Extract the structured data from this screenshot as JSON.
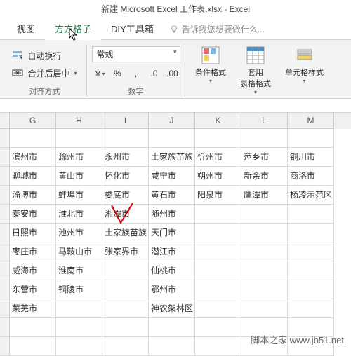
{
  "title": "新建 Microsoft Excel 工作表.xlsx - Excel",
  "tabs": {
    "view": "视图",
    "ffgz": "方方格子",
    "diy": "DIY工具箱"
  },
  "tell_me": "告诉我您想要做什么...",
  "alignment": {
    "wrap": "自动换行",
    "merge": "合并后居中",
    "label": "对齐方式"
  },
  "number": {
    "format": "常规",
    "label": "数字",
    "currency": "￥",
    "percent": "%",
    "comma": ",",
    "dec_inc": ".0",
    "dec_dec": ".00"
  },
  "styles": {
    "cond": "条件格式",
    "table": "套用\n表格格式",
    "cell": "单元格样式"
  },
  "columns": [
    "G",
    "H",
    "I",
    "J",
    "K",
    "L",
    "M"
  ],
  "grid": [
    [
      "",
      "",
      "",
      "",
      "",
      "",
      ""
    ],
    [
      "滨州市",
      "滁州市",
      "永州市",
      "土家族苗族自",
      "忻州市",
      "萍乡市",
      "铜川市"
    ],
    [
      "聊城市",
      "黄山市",
      "怀化市",
      "咸宁市",
      "朔州市",
      "新余市",
      "商洛市"
    ],
    [
      "淄博市",
      "蚌埠市",
      "娄底市",
      "黄石市",
      "阳泉市",
      "鹰潭市",
      "杨凌示范区"
    ],
    [
      "泰安市",
      "淮北市",
      "湘潭市",
      "随州市",
      "",
      "",
      ""
    ],
    [
      "日照市",
      "池州市",
      "土家族苗族自",
      "天门市",
      "",
      "",
      ""
    ],
    [
      "枣庄市",
      "马鞍山市",
      "张家界市",
      "潜江市",
      "",
      "",
      ""
    ],
    [
      "威海市",
      "淮南市",
      "",
      "仙桃市",
      "",
      "",
      ""
    ],
    [
      "东营市",
      "铜陵市",
      "",
      "鄂州市",
      "",
      "",
      ""
    ],
    [
      "莱芜市",
      "",
      "",
      "神农架林区",
      "",
      "",
      ""
    ],
    [
      "",
      "",
      "",
      "",
      "",
      "",
      ""
    ],
    [
      "",
      "",
      "",
      "",
      "",
      "",
      ""
    ]
  ],
  "footer": "脚本之家  www.jb51.net"
}
